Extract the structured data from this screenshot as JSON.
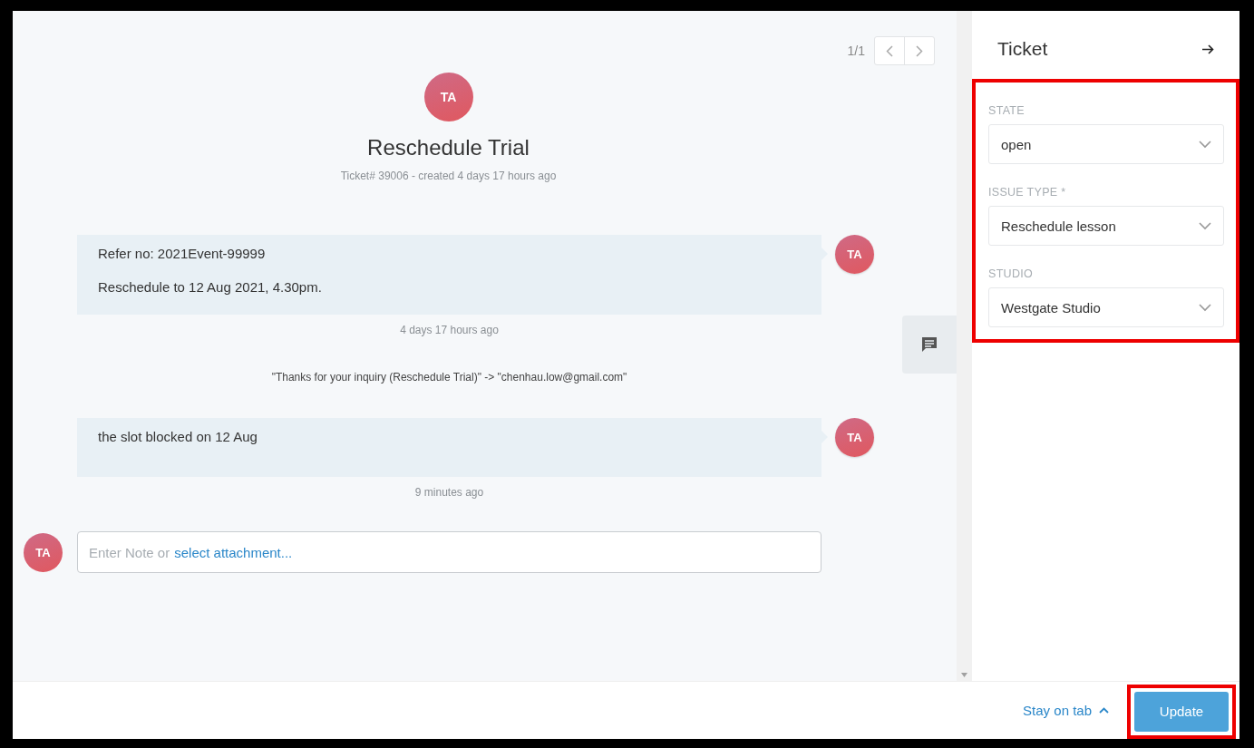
{
  "pagination": {
    "text": "1/1"
  },
  "ticket": {
    "avatar": "TA",
    "title": "Reschedule Trial",
    "meta": "Ticket# 39006 - created 4 days 17 hours ago"
  },
  "articles": [
    {
      "kind": "message",
      "lines": [
        "Refer no: 2021Event-99999",
        "Reschedule to 12 Aug 2021, 4.30pm."
      ],
      "avatar": "TA",
      "time": "4 days 17 hours ago"
    },
    {
      "kind": "event",
      "text": "\"Thanks for your inquiry (Reschedule Trial)\" -> \"chenhau.low@gmail.com\""
    },
    {
      "kind": "message",
      "lines": [
        "the slot blocked on 12 Aug"
      ],
      "avatar": "TA",
      "time": "9 minutes ago"
    }
  ],
  "reply": {
    "avatar": "TA",
    "placeholder": "Enter Note or",
    "link": "select attachment..."
  },
  "sidebar": {
    "title": "Ticket",
    "highlighted": true,
    "fields": [
      {
        "label": "STATE",
        "value": "open"
      },
      {
        "label": "ISSUE TYPE *",
        "value": "Reschedule lesson"
      },
      {
        "label": "STUDIO",
        "value": "Westgate Studio"
      }
    ]
  },
  "footer": {
    "stay_on_tab": "Stay on tab",
    "update": {
      "label": "Update",
      "highlighted": true
    }
  }
}
